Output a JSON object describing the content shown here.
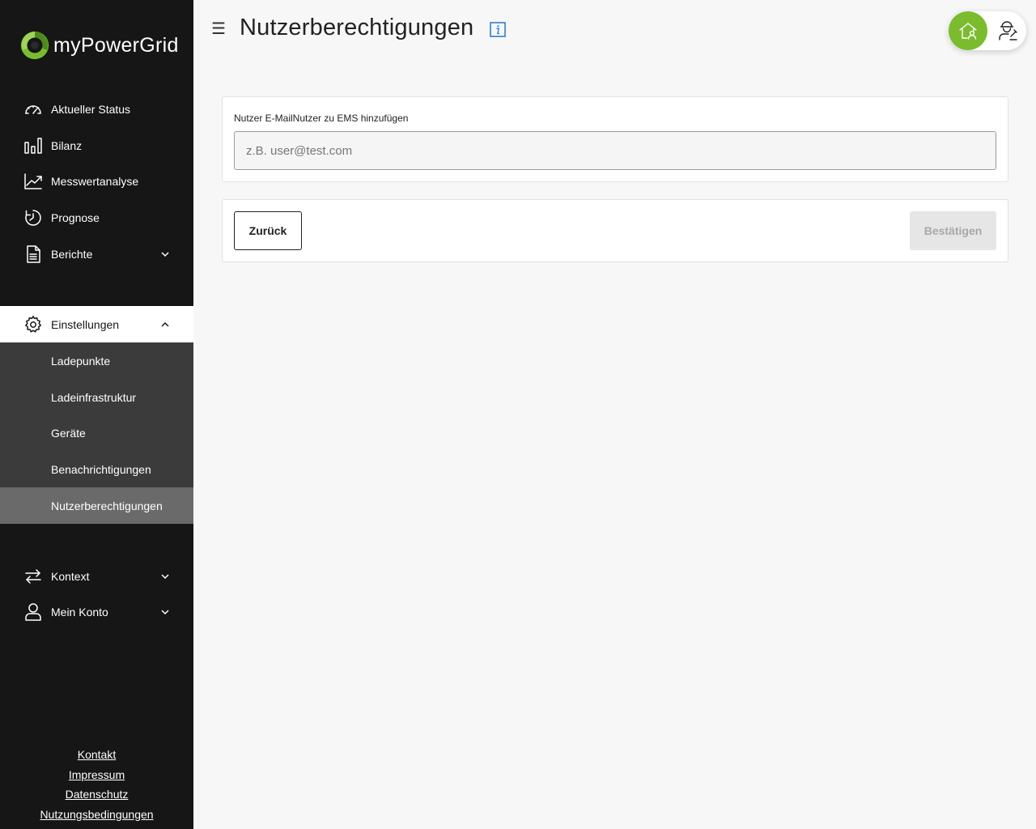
{
  "app": {
    "brand": "myPowerGrid",
    "accent_color": "#7bbc2f"
  },
  "sidebar": {
    "items": [
      {
        "label": "Aktueller Status",
        "icon": "gauge-icon"
      },
      {
        "label": "Bilanz",
        "icon": "bar-chart-icon"
      },
      {
        "label": "Messwertanalyse",
        "icon": "line-chart-icon"
      },
      {
        "label": "Prognose",
        "icon": "forecast-clock-icon"
      },
      {
        "label": "Berichte",
        "icon": "document-icon"
      },
      {
        "label": "Einstellungen",
        "icon": "gear-icon"
      },
      {
        "label": "Kontext",
        "icon": "swap-arrows-icon"
      },
      {
        "label": "Mein Konto",
        "icon": "user-icon"
      }
    ],
    "settings_subitems": [
      {
        "label": "Ladepunkte"
      },
      {
        "label": "Ladeinfrastruktur"
      },
      {
        "label": "Geräte"
      },
      {
        "label": "Benachrichtigungen"
      },
      {
        "label": "Nutzerberechtigungen"
      }
    ],
    "footer_links": [
      "Kontakt",
      "Impressum",
      "Datenschutz",
      "Nutzungsbedingungen"
    ]
  },
  "header": {
    "title": "Nutzerberechtigungen"
  },
  "form": {
    "label": "Nutzer E-MailNutzer zu EMS hinzufügen",
    "email_placeholder": "z.B. user@test.com",
    "email_value": ""
  },
  "actions": {
    "back_label": "Zurück",
    "confirm_label": "Bestätigen"
  }
}
